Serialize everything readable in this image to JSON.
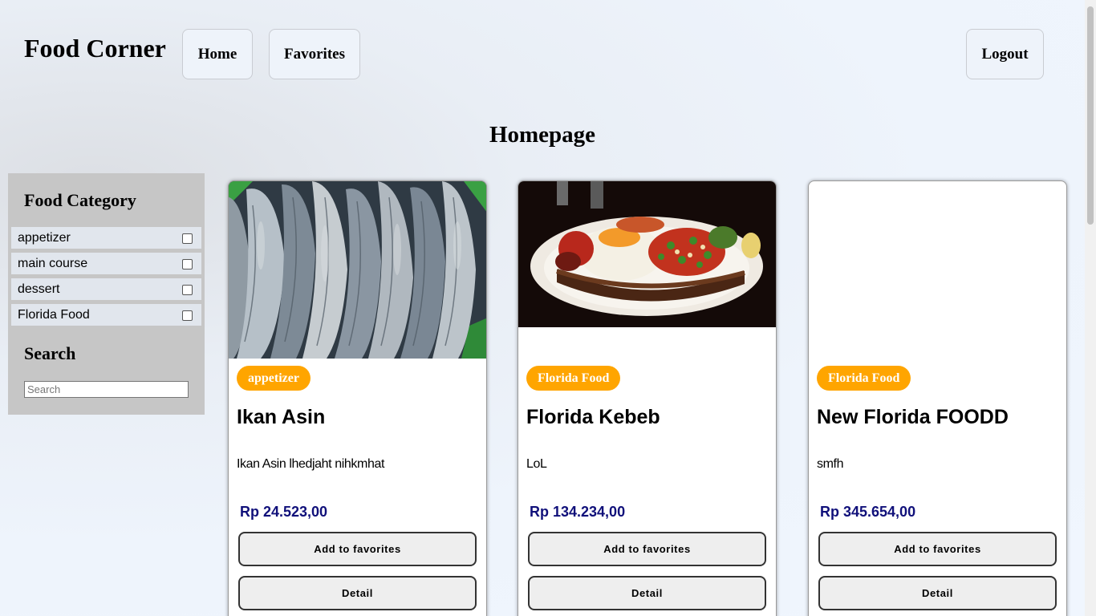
{
  "header": {
    "brand": "Food Corner",
    "nav": {
      "home": "Home",
      "favorites": "Favorites",
      "logout": "Logout"
    }
  },
  "page_title": "Homepage",
  "sidebar": {
    "category_title": "Food Category",
    "categories": [
      {
        "label": "appetizer",
        "checked": false
      },
      {
        "label": "main course",
        "checked": false
      },
      {
        "label": "dessert",
        "checked": false
      },
      {
        "label": "Florida Food",
        "checked": false
      }
    ],
    "search_title": "Search",
    "search_placeholder": "Search"
  },
  "cards": [
    {
      "category": "appetizer",
      "title": "Ikan Asin",
      "description": "Ikan Asin lhedjaht  nihkmhat",
      "price": "Rp 24.523,00",
      "image": "dried-fish-photo",
      "add_label": "Add to favorites",
      "detail_label": "Detail"
    },
    {
      "category": "Florida Food",
      "title": "Florida Kebeb",
      "description": "LoL",
      "price": "Rp 134.234,00",
      "image": "kebab-plate-photo",
      "add_label": "Add to favorites",
      "detail_label": "Detail"
    },
    {
      "category": "Florida Food",
      "title": "New Florida FOODD",
      "description": "smfh",
      "price": "Rp 345.654,00",
      "image": "",
      "add_label": "Add to favorites",
      "detail_label": "Detail"
    }
  ],
  "colors": {
    "badge": "#ffa500",
    "price": "#10107a",
    "sidebar_bg": "#c6c6c6"
  }
}
